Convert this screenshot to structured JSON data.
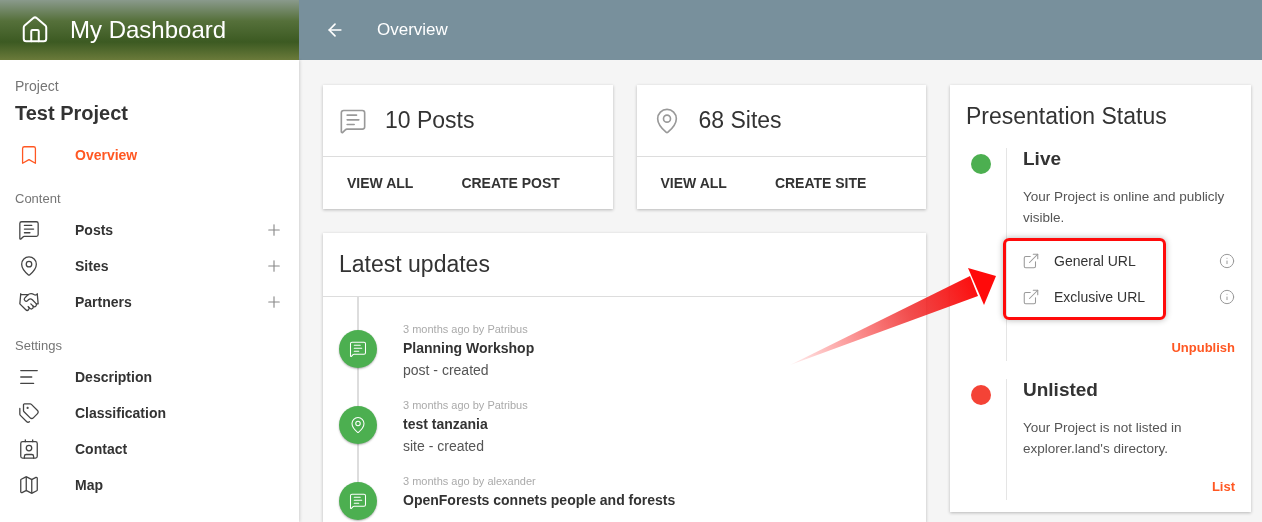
{
  "header": {
    "title": "My Dashboard",
    "page_title": "Overview"
  },
  "sidebar": {
    "project_label": "Project",
    "project_name": "Test Project",
    "sections": [
      {
        "items": [
          {
            "label": "Overview",
            "selected": true,
            "addable": false
          }
        ]
      },
      {
        "heading": "Content",
        "items": [
          {
            "label": "Posts",
            "selected": false,
            "addable": true
          },
          {
            "label": "Sites",
            "selected": false,
            "addable": true
          },
          {
            "label": "Partners",
            "selected": false,
            "addable": true
          }
        ]
      },
      {
        "heading": "Settings",
        "items": [
          {
            "label": "Description",
            "selected": false,
            "addable": false
          },
          {
            "label": "Classification",
            "selected": false,
            "addable": false
          },
          {
            "label": "Contact",
            "selected": false,
            "addable": false
          },
          {
            "label": "Map",
            "selected": false,
            "addable": false
          }
        ]
      }
    ]
  },
  "summary_cards": [
    {
      "title": "10 Posts",
      "actions": [
        "VIEW ALL",
        "CREATE POST"
      ]
    },
    {
      "title": "68 Sites",
      "actions": [
        "VIEW ALL",
        "CREATE SITE"
      ]
    }
  ],
  "latest_updates": {
    "title": "Latest updates",
    "entries": [
      {
        "kind": "post",
        "meta": "3 months ago by Patribus",
        "title": "Planning Workshop",
        "action": "post - created"
      },
      {
        "kind": "site",
        "meta": "3 months ago by Patribus",
        "title": "test tanzania",
        "action": "site - created"
      },
      {
        "kind": "post",
        "meta": "3 months ago by alexander",
        "title": "OpenForests connets people and forests"
      }
    ]
  },
  "presentation_status": {
    "title": "Presentation Status",
    "states": [
      {
        "name": "Live",
        "color": "#4caf50",
        "description": "Your Project is online and publicly visible.",
        "links": [
          "General URL",
          "Exclusive URL"
        ],
        "action": "Unpublish"
      },
      {
        "name": "Unlisted",
        "color": "#f44336",
        "description": "Your Project is not listed in explorer.land's directory.",
        "action": "List"
      }
    ]
  }
}
